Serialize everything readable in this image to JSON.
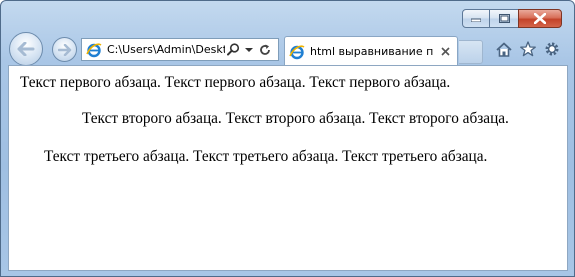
{
  "address_bar": {
    "url_text": "C:\\Users\\Admin\\Deskt"
  },
  "tab": {
    "title": "html выравнивание п..."
  },
  "content": {
    "paragraphs": [
      "Текст первого абзаца. Текст первого абзаца. Текст первого абзаца.",
      "Текст второго абзаца. Текст второго абзаца. Текст второго абзаца.",
      "Текст третьего абзаца. Текст третьего абзаца. Текст третьего абзаца."
    ]
  },
  "colors": {
    "frame": "#a9c6e6",
    "close_button": "#c3432a",
    "page_background": "#ffffff",
    "text": "#000000"
  }
}
